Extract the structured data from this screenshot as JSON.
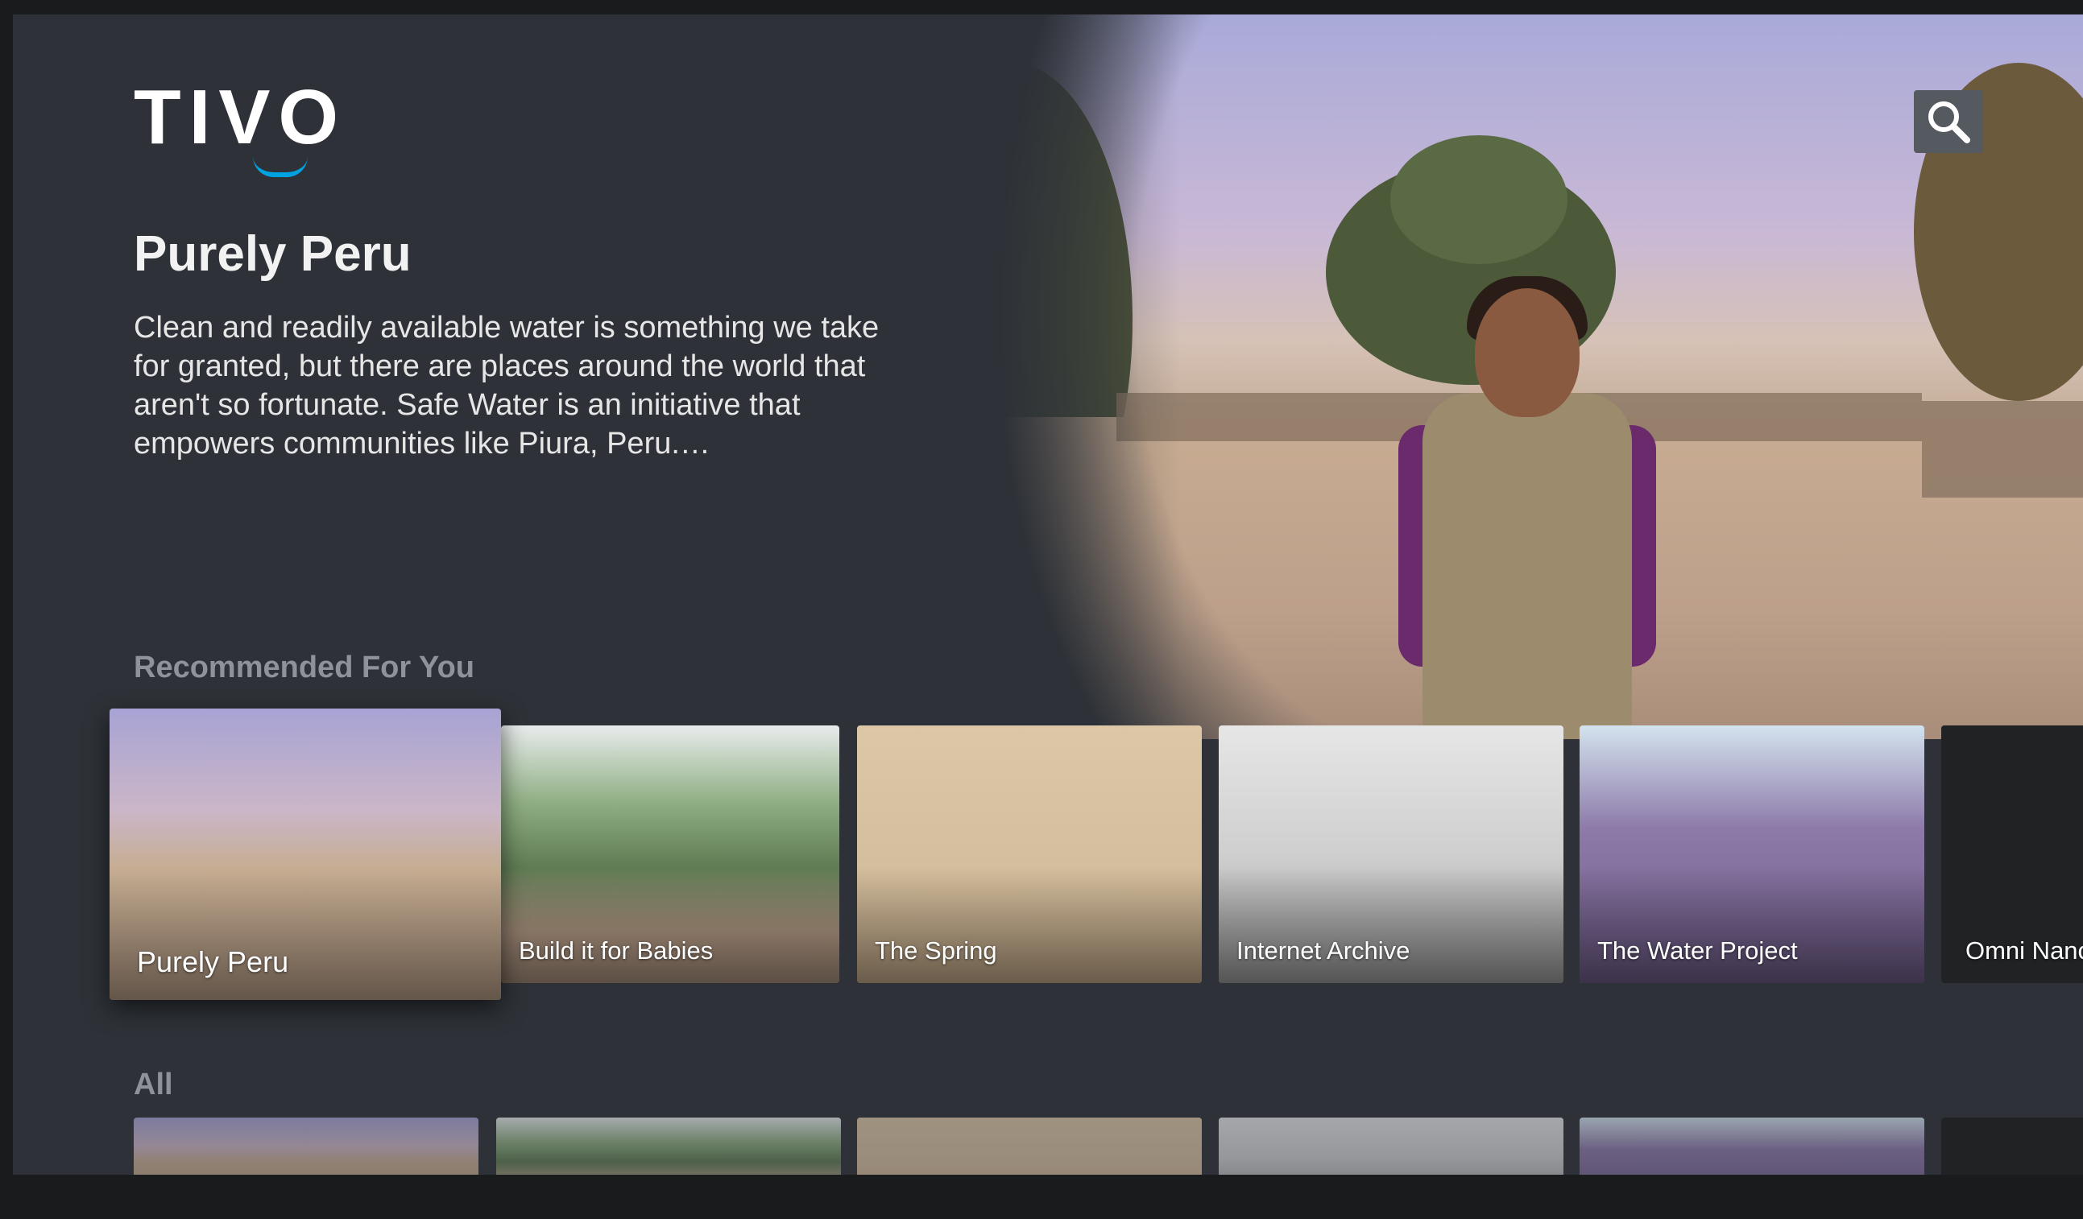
{
  "app": {
    "logo_text": "TIVO"
  },
  "header": {
    "search_icon": "search-icon"
  },
  "featured": {
    "title": "Purely Peru",
    "description": "Clean and readily available water is something we take for granted, but there are places around the world that aren't so fortunate. Safe Water is an initiative that empowers communities like Piura, Peru.…"
  },
  "rows": {
    "recommended": {
      "label": "Recommended For You",
      "items": [
        {
          "title": "Purely Peru"
        },
        {
          "title": "Build it for Babies"
        },
        {
          "title": "The Spring"
        },
        {
          "title": "Internet Archive"
        },
        {
          "title": "The Water Project"
        },
        {
          "title": "Omni Nanc"
        }
      ]
    },
    "all": {
      "label": "All"
    }
  },
  "colors": {
    "accent": "#00a3e0",
    "background": "#2e3238",
    "row_label": "#8e939a"
  }
}
